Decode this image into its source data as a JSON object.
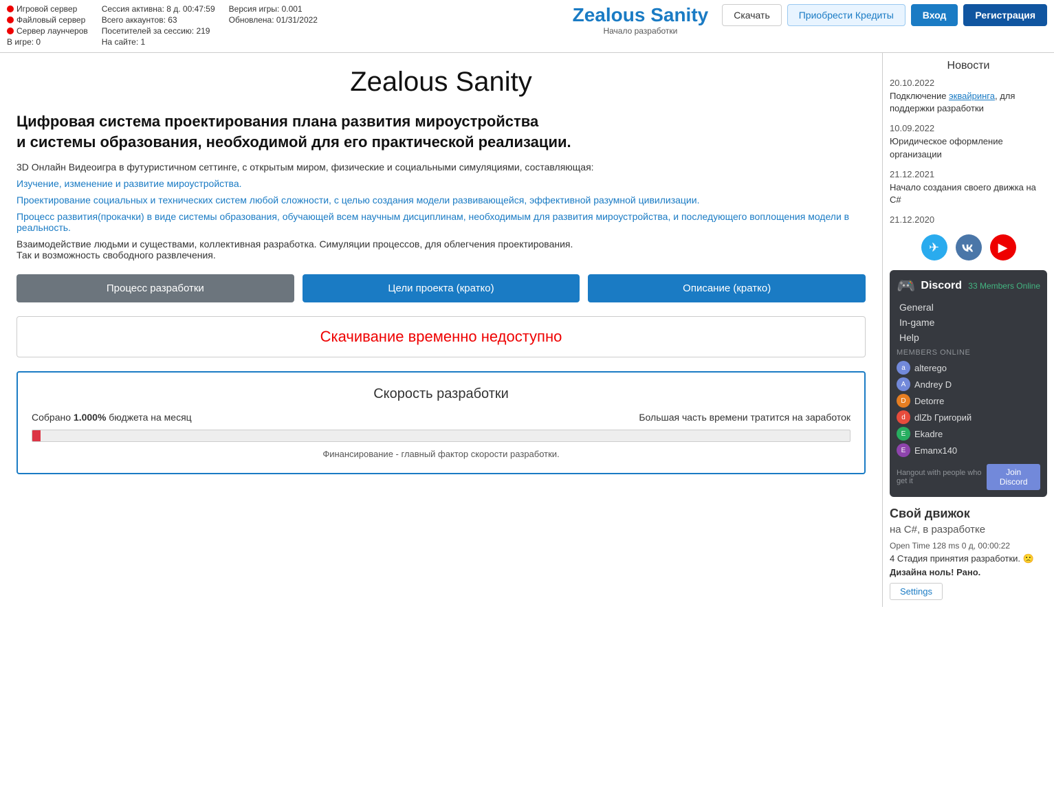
{
  "topbar": {
    "servers": [
      {
        "label": "Игровой сервер",
        "status": "red"
      },
      {
        "label": "Файловый сервер",
        "status": "red"
      },
      {
        "label": "Сервер лаунчеров",
        "status": "red"
      }
    ],
    "in_game_label": "В игре: 0",
    "session": {
      "session_label": "Сессия активна:",
      "session_value": "8 д. 00:47:59",
      "accounts_label": "Всего аккаунтов:",
      "accounts_value": "63",
      "visitors_label": "Посетителей за сессию:",
      "visitors_value": "219",
      "online_label": "На сайте:",
      "online_value": "1"
    },
    "version": {
      "version_label": "Версия игры:",
      "version_value": "0.001",
      "update_label": "Обновлена:",
      "update_value": "01/31/2022"
    },
    "title": "Zealous Sanity",
    "subtitle": "Начало разработки",
    "buttons": {
      "download": "Скачать",
      "purchase": "Приобрести Кредиты",
      "login": "Вход",
      "register": "Регистрация"
    }
  },
  "main": {
    "page_title": "Zealous Sanity",
    "tagline": "Цифровая система проектирования плана развития мироустройства\nи системы образования, необходимой для его практической реализации.",
    "desc1": "3D Онлайн Видеоигра в футуристичном сеттинге, с открытым миром, физические и социальными симуляциями, составляющая:",
    "link1": "Изучение, изменение и развитие мироустройства.",
    "link2": "Проектирование социальных и технических систем любой сложности, с целью создания модели развивающейся, эффективной разумной цивилизации.",
    "link3": "Процесс развития(прокачки) в виде системы образования, обучающей всем научным дисциплинам, необходимым для развития мироустройства, и последующего воплощения модели в реальность.",
    "desc2": "Взаимодействие людьми и существами, коллективная разработка. Симуляции процессов, для облегчения проектирования.\nТак и возможность свободного развлечения.",
    "buttons": {
      "dev_process": "Процесс разработки",
      "project_goals": "Цели проекта (кратко)",
      "description": "Описание (кратко)"
    },
    "download_banner": "Скачивание временно недоступно",
    "dev_speed": {
      "title": "Скорость разработки",
      "collected_label": "Собрано",
      "collected_pct": "1.000%",
      "collected_suffix": "бюджета на месяц",
      "time_note": "Большая часть времени тратится на заработок",
      "progress_pct": 1,
      "financing_note": "Финансирование - главный фактор скорости разработки."
    }
  },
  "sidebar": {
    "news_title": "Новости",
    "news_items": [
      {
        "date": "20.10.2022",
        "text_before": "Подключение ",
        "link_text": "эквайринга",
        "text_after": ", для поддержки разработки"
      },
      {
        "date": "10.09.2022",
        "text_before": "",
        "link_text": "",
        "text_after": "Юридическое оформление организации"
      },
      {
        "date": "21.12.2021",
        "text_before": "",
        "link_text": "",
        "text_after": "Начало создания своего движка на С#"
      },
      {
        "date": "21.12.2020",
        "text_before": "",
        "link_text": "",
        "text_after": ""
      }
    ],
    "socials": {
      "telegram_label": "Telegram",
      "vk_label": "VK",
      "youtube_label": "YouTube"
    },
    "discord": {
      "name": "Discord",
      "members_online_count": "33 Members Online",
      "channels": [
        "General",
        "In-game",
        "Help"
      ],
      "members_label": "MEMBERS ONLINE",
      "members": [
        "alterego",
        "Andrey D",
        "Detorre",
        "dlZb Григорий",
        "Ekadre",
        "Emanx140"
      ],
      "hangout_text": "Hangout with people who get it",
      "join_btn": "Join Discord"
    },
    "engine": {
      "title": "Свой движок",
      "subtitle": "на С#, в разработке",
      "open_time": "Open Time 128 ms 0 д, 00:00:22",
      "stage": "4 Стадия принятия разработки. 🙁",
      "warning": "Дизайна ноль! Рано.",
      "settings_btn": "Settings"
    }
  }
}
